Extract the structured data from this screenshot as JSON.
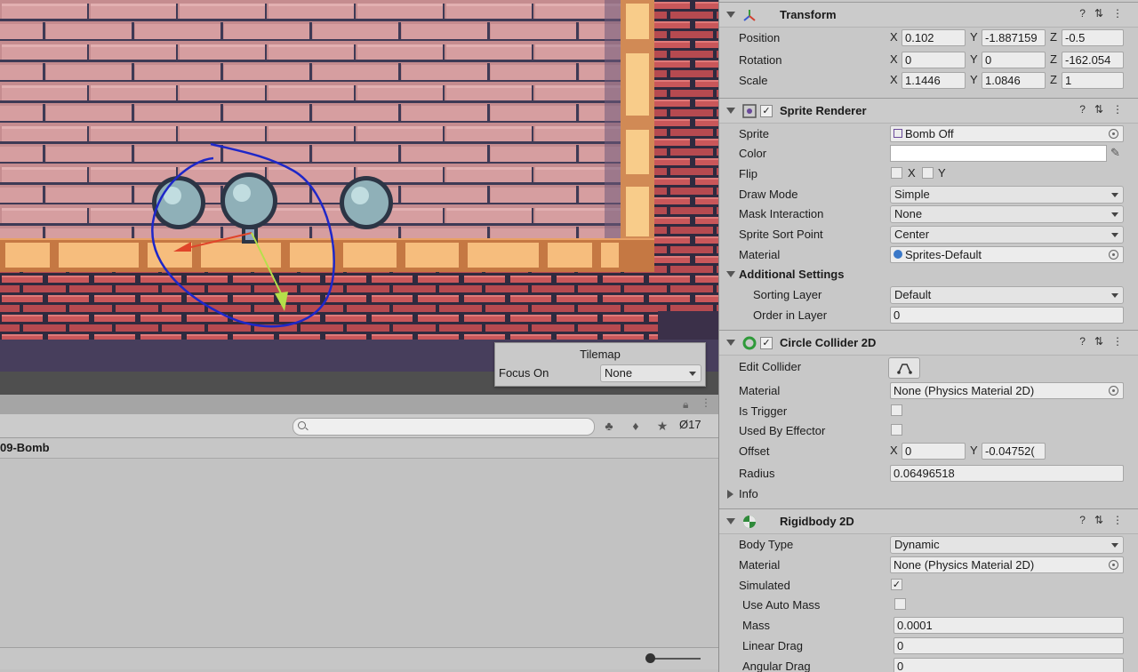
{
  "scene": {
    "tilemap_overlay": {
      "title": "Tilemap",
      "focus_label": "Focus On",
      "focus_value": "None"
    }
  },
  "bottom_panel": {
    "path": "09-Bomb",
    "hidden_count": "17",
    "search_placeholder": ""
  },
  "inspector": {
    "transform": {
      "title": "Transform",
      "position": {
        "label": "Position",
        "x": "0.102",
        "y": "-1.887159",
        "z": "-0.5"
      },
      "rotation": {
        "label": "Rotation",
        "x": "0",
        "y": "0",
        "z": "-162.054"
      },
      "scale": {
        "label": "Scale",
        "x": "1.1446",
        "y": "1.0846",
        "z": "1"
      }
    },
    "sprite_renderer": {
      "title": "Sprite Renderer",
      "sprite_label": "Sprite",
      "sprite_value": "Bomb Off",
      "color_label": "Color",
      "color_value": "#ffffff",
      "flip_label": "Flip",
      "flip_x": "X",
      "flip_y": "Y",
      "draw_mode_label": "Draw Mode",
      "draw_mode_value": "Simple",
      "mask_label": "Mask Interaction",
      "mask_value": "None",
      "sort_point_label": "Sprite Sort Point",
      "sort_point_value": "Center",
      "material_label": "Material",
      "material_value": "Sprites-Default",
      "additional_label": "Additional Settings",
      "sorting_layer_label": "Sorting Layer",
      "sorting_layer_value": "Default",
      "order_label": "Order in Layer",
      "order_value": "0"
    },
    "circle_collider": {
      "title": "Circle Collider 2D",
      "edit_label": "Edit Collider",
      "material_label": "Material",
      "material_value": "None (Physics Material 2D)",
      "trigger_label": "Is Trigger",
      "effector_label": "Used By Effector",
      "offset_label": "Offset",
      "offset_x": "0",
      "offset_y": "-0.04752(",
      "radius_label": "Radius",
      "radius_value": "0.06496518",
      "info_label": "Info"
    },
    "rigidbody": {
      "title": "Rigidbody 2D",
      "body_type_label": "Body Type",
      "body_type_value": "Dynamic",
      "material_label": "Material",
      "material_value": "None (Physics Material 2D)",
      "simulated_label": "Simulated",
      "auto_mass_label": "Use Auto Mass",
      "mass_label": "Mass",
      "mass_value": "0.0001",
      "linear_drag_label": "Linear Drag",
      "linear_drag_value": "0",
      "angular_drag_label": "Angular Drag",
      "angular_drag_value": "0"
    },
    "axis_labels": {
      "x": "X",
      "y": "Y",
      "z": "Z"
    },
    "check_mark": "✓"
  }
}
